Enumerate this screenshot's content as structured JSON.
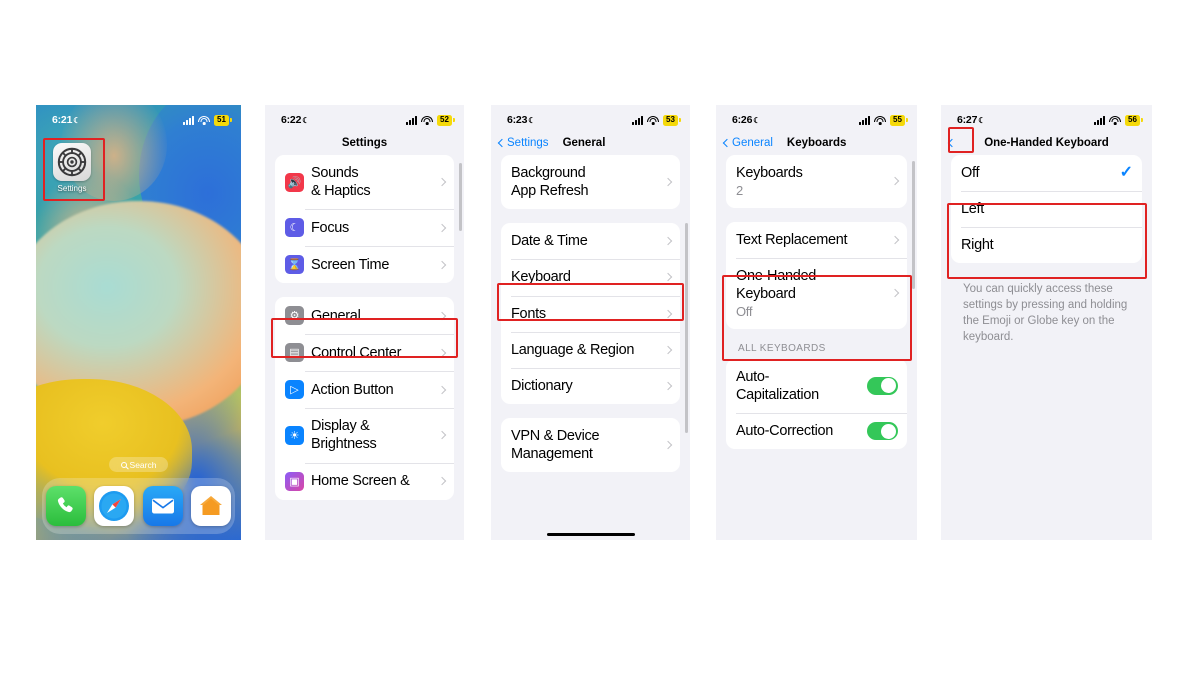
{
  "panels": {
    "home": {
      "status": {
        "time": "6:21",
        "battery": "51"
      },
      "app": {
        "label": "Settings",
        "icon": "settings-gear-icon"
      },
      "search": {
        "label": "Search",
        "icon": "search-icon"
      },
      "dock": [
        {
          "name": "phone",
          "icon": "phone-icon"
        },
        {
          "name": "safari",
          "icon": "safari-compass-icon"
        },
        {
          "name": "mail",
          "icon": "mail-envelope-icon"
        },
        {
          "name": "home",
          "icon": "home-house-icon"
        }
      ]
    },
    "settings": {
      "status": {
        "time": "6:22",
        "battery": "52"
      },
      "nav": {
        "title": "Settings"
      },
      "group1": [
        {
          "label": "Sounds\n& Haptics",
          "icon": "speaker-icon"
        },
        {
          "label": "Focus",
          "icon": "moon-icon"
        },
        {
          "label": "Screen Time",
          "icon": "hourglass-icon"
        }
      ],
      "group2": [
        {
          "label": "General",
          "icon": "gear-icon"
        },
        {
          "label": "Control Center",
          "icon": "control-center-icon"
        },
        {
          "label": "Action Button",
          "icon": "action-button-icon"
        },
        {
          "label": "Display &\nBrightness",
          "icon": "brightness-icon"
        },
        {
          "label": "Home Screen &",
          "icon": "home-screen-icon"
        }
      ]
    },
    "general": {
      "status": {
        "time": "6:23",
        "battery": "53"
      },
      "nav": {
        "back": "Settings",
        "title": "General"
      },
      "group1": [
        {
          "label": "Background\nApp Refresh"
        }
      ],
      "group2": [
        {
          "label": "Date & Time"
        },
        {
          "label": "Keyboard"
        },
        {
          "label": "Fonts"
        },
        {
          "label": "Language & Region"
        },
        {
          "label": "Dictionary"
        }
      ],
      "group3": [
        {
          "label": "VPN & Device\nManagement"
        }
      ]
    },
    "keyboards": {
      "status": {
        "time": "6:26",
        "battery": "55"
      },
      "nav": {
        "back": "General",
        "title": "Keyboards"
      },
      "group1": [
        {
          "label": "Keyboards",
          "sub": "2"
        }
      ],
      "group2": [
        {
          "label": "Text Replacement"
        },
        {
          "label": "One-Handed\nKeyboard",
          "sub": "Off"
        }
      ],
      "section_header": "ALL KEYBOARDS",
      "group3": [
        {
          "label": "Auto-\nCapitalization",
          "toggle": "on"
        },
        {
          "label": "Auto-Correction",
          "toggle": "on"
        }
      ]
    },
    "onehanded": {
      "status": {
        "time": "6:27",
        "battery": "56"
      },
      "nav": {
        "title": "One-Handed Keyboard"
      },
      "options": [
        {
          "label": "Off",
          "selected": true
        },
        {
          "label": "Left",
          "selected": false
        },
        {
          "label": "Right",
          "selected": false
        }
      ],
      "footnote": "You can quickly access these settings by pressing and holding the Emoji or Globe key on the keyboard."
    }
  },
  "highlight_color": "#e02222"
}
